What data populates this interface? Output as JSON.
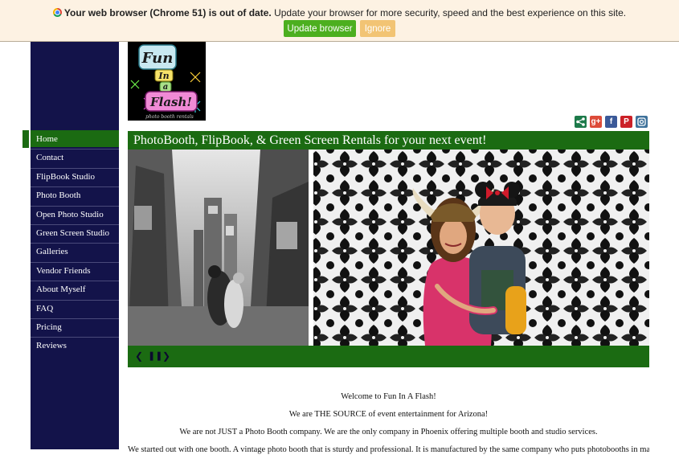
{
  "browser_banner": {
    "bold_text": "Your web browser (Chrome 51) is out of date.",
    "text": " Update your browser for more security, speed and the best experience on this site.",
    "update_button": "Update browser",
    "ignore_button": "Ignore"
  },
  "logo": {
    "line1": "Fun",
    "line2": "In",
    "line3": "a",
    "line4": "Flash!",
    "tagline": "photo booth rentals"
  },
  "nav": {
    "items": [
      {
        "label": "Home",
        "active": true
      },
      {
        "label": "Contact"
      },
      {
        "label": "FlipBook Studio"
      },
      {
        "label": "Photo Booth"
      },
      {
        "label": "Open Photo Studio"
      },
      {
        "label": "Green Screen Studio"
      },
      {
        "label": "Galleries"
      },
      {
        "label": "Vendor Friends"
      },
      {
        "label": "About Myself"
      },
      {
        "label": "FAQ"
      },
      {
        "label": "Pricing"
      },
      {
        "label": "Reviews"
      }
    ]
  },
  "social": {
    "icons": [
      "share-icon",
      "google-plus-icon",
      "facebook-icon",
      "pinterest-icon",
      "instagram-icon"
    ],
    "colors": {
      "share": "#1d7a4a",
      "google_plus": "#dd4b39",
      "facebook": "#3b5998",
      "pinterest": "#cb2027",
      "instagram": "#3f729b"
    },
    "labels": {
      "google_plus": "g+",
      "facebook": "f",
      "pinterest": "P"
    }
  },
  "hero": {
    "title": "PhotoBooth, FlipBook, & Green Screen Rentals for your next event!"
  },
  "content": {
    "p1": "Welcome to Fun In A Flash!",
    "p2": "We are THE SOURCE of event entertainment for Arizona!",
    "p3": "We are not JUST a Photo Booth company. We are the only company in Phoenix offering multiple booth and studio services.",
    "p4": "We started out with one booth. A vintage photo booth that is sturdy and professional. It is manufactured by the same company who puts photobooths in malls and"
  },
  "colors": {
    "navy": "#13134a",
    "green": "#1b6b12",
    "banner_bg": "#fdf2e3",
    "update_btn": "#4caf1f",
    "ignore_btn": "#f2c474"
  }
}
